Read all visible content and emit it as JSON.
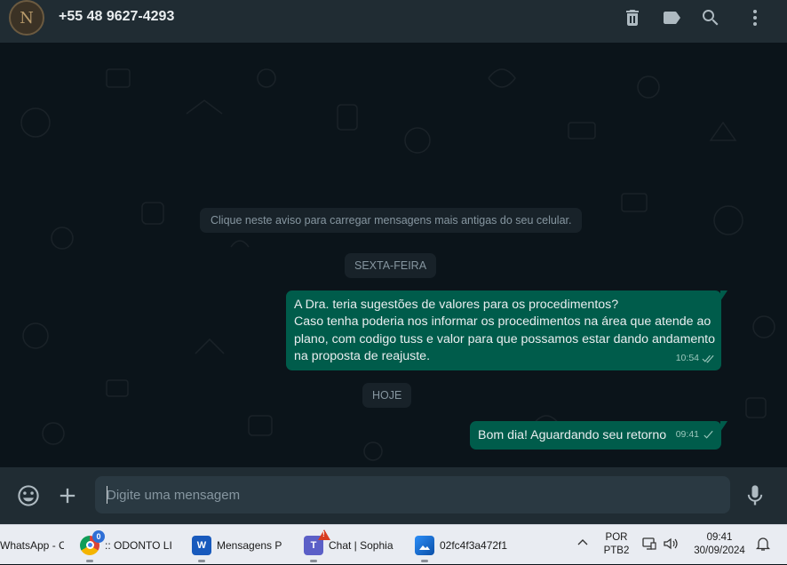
{
  "header": {
    "avatar_letter": "N",
    "contact_name": "+55 48 9627-4293",
    "icons": [
      "trash-icon",
      "label-icon",
      "search-icon",
      "menu-dots-icon"
    ]
  },
  "chat": {
    "system_notice": "Clique neste aviso para carregar mensagens mais antigas do seu celular.",
    "date_friday": "SEXTA-FEIRA",
    "date_today": "HOJE",
    "messages": [
      {
        "lines": [
          "A Dra. teria sugestões de valores para os procedimentos?",
          "Caso tenha poderia nos informar os procedimentos na área que atende ao",
          "plano, com codigo tuss e valor para que possamos estar dando andamento",
          "na proposta de reajuste."
        ],
        "time": "10:54",
        "status": "read"
      },
      {
        "lines": [
          "Bom dia! Aguardando seu retorno"
        ],
        "time": "09:41",
        "status": "delivered"
      }
    ]
  },
  "composer": {
    "placeholder": "Digite uma mensagem",
    "icons": [
      "emoji-icon",
      "plus-icon",
      "mic-icon"
    ]
  },
  "taskbar": {
    "items": [
      {
        "label": "WhatsApp - C"
      },
      {
        "label": ":: ODONTO LI",
        "badge": "0"
      },
      {
        "label": "Mensagens P"
      },
      {
        "label": "Chat | Sophia",
        "badge": "!"
      },
      {
        "label": "02fc4f3a472f1"
      }
    ],
    "lang_top": "POR",
    "lang_bottom": "PTB2",
    "time": "09:41",
    "date": "30/09/2024"
  },
  "colors": {
    "header_bg": "#202c33",
    "chat_bg": "#0b141a",
    "bubble_out": "#005c4b",
    "input_bg": "#2a3942",
    "taskbar_bg": "#e9ecf2"
  }
}
